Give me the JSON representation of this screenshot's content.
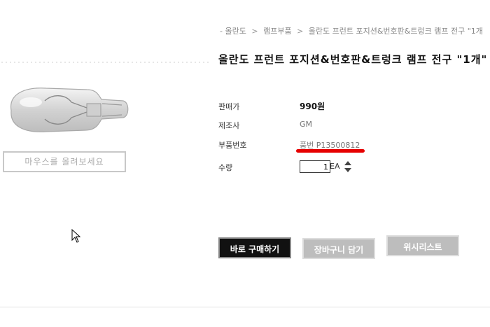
{
  "breadcrumb": {
    "prefix": "-",
    "items": [
      "올란도",
      "램프부품",
      "올란도 프런트 포지션&번호판&트렁크 램프 전구 \"1개"
    ],
    "separator": ">"
  },
  "product": {
    "title": "올란도 프런트 포지션&번호판&트렁크 램프 전구 \"1개\"",
    "zoom_hint": "마우스를 올려보세요",
    "image_icon": "bulb-image"
  },
  "info": {
    "price_label": "판매가",
    "price_value": "990원",
    "maker_label": "제조사",
    "maker_value": "GM",
    "part_label": "부품번호",
    "part_value": "품번 P13500812",
    "qty_label": "수량",
    "qty_value": "1",
    "qty_unit": "EA"
  },
  "buttons": {
    "buy_now": "바로 구매하기",
    "add_cart": "장바구니 담기",
    "wishlist": "위시리스트"
  },
  "colors": {
    "buy_bg": "#111111",
    "secondary_bg": "#bdbdbd",
    "highlight": "#e60000"
  }
}
